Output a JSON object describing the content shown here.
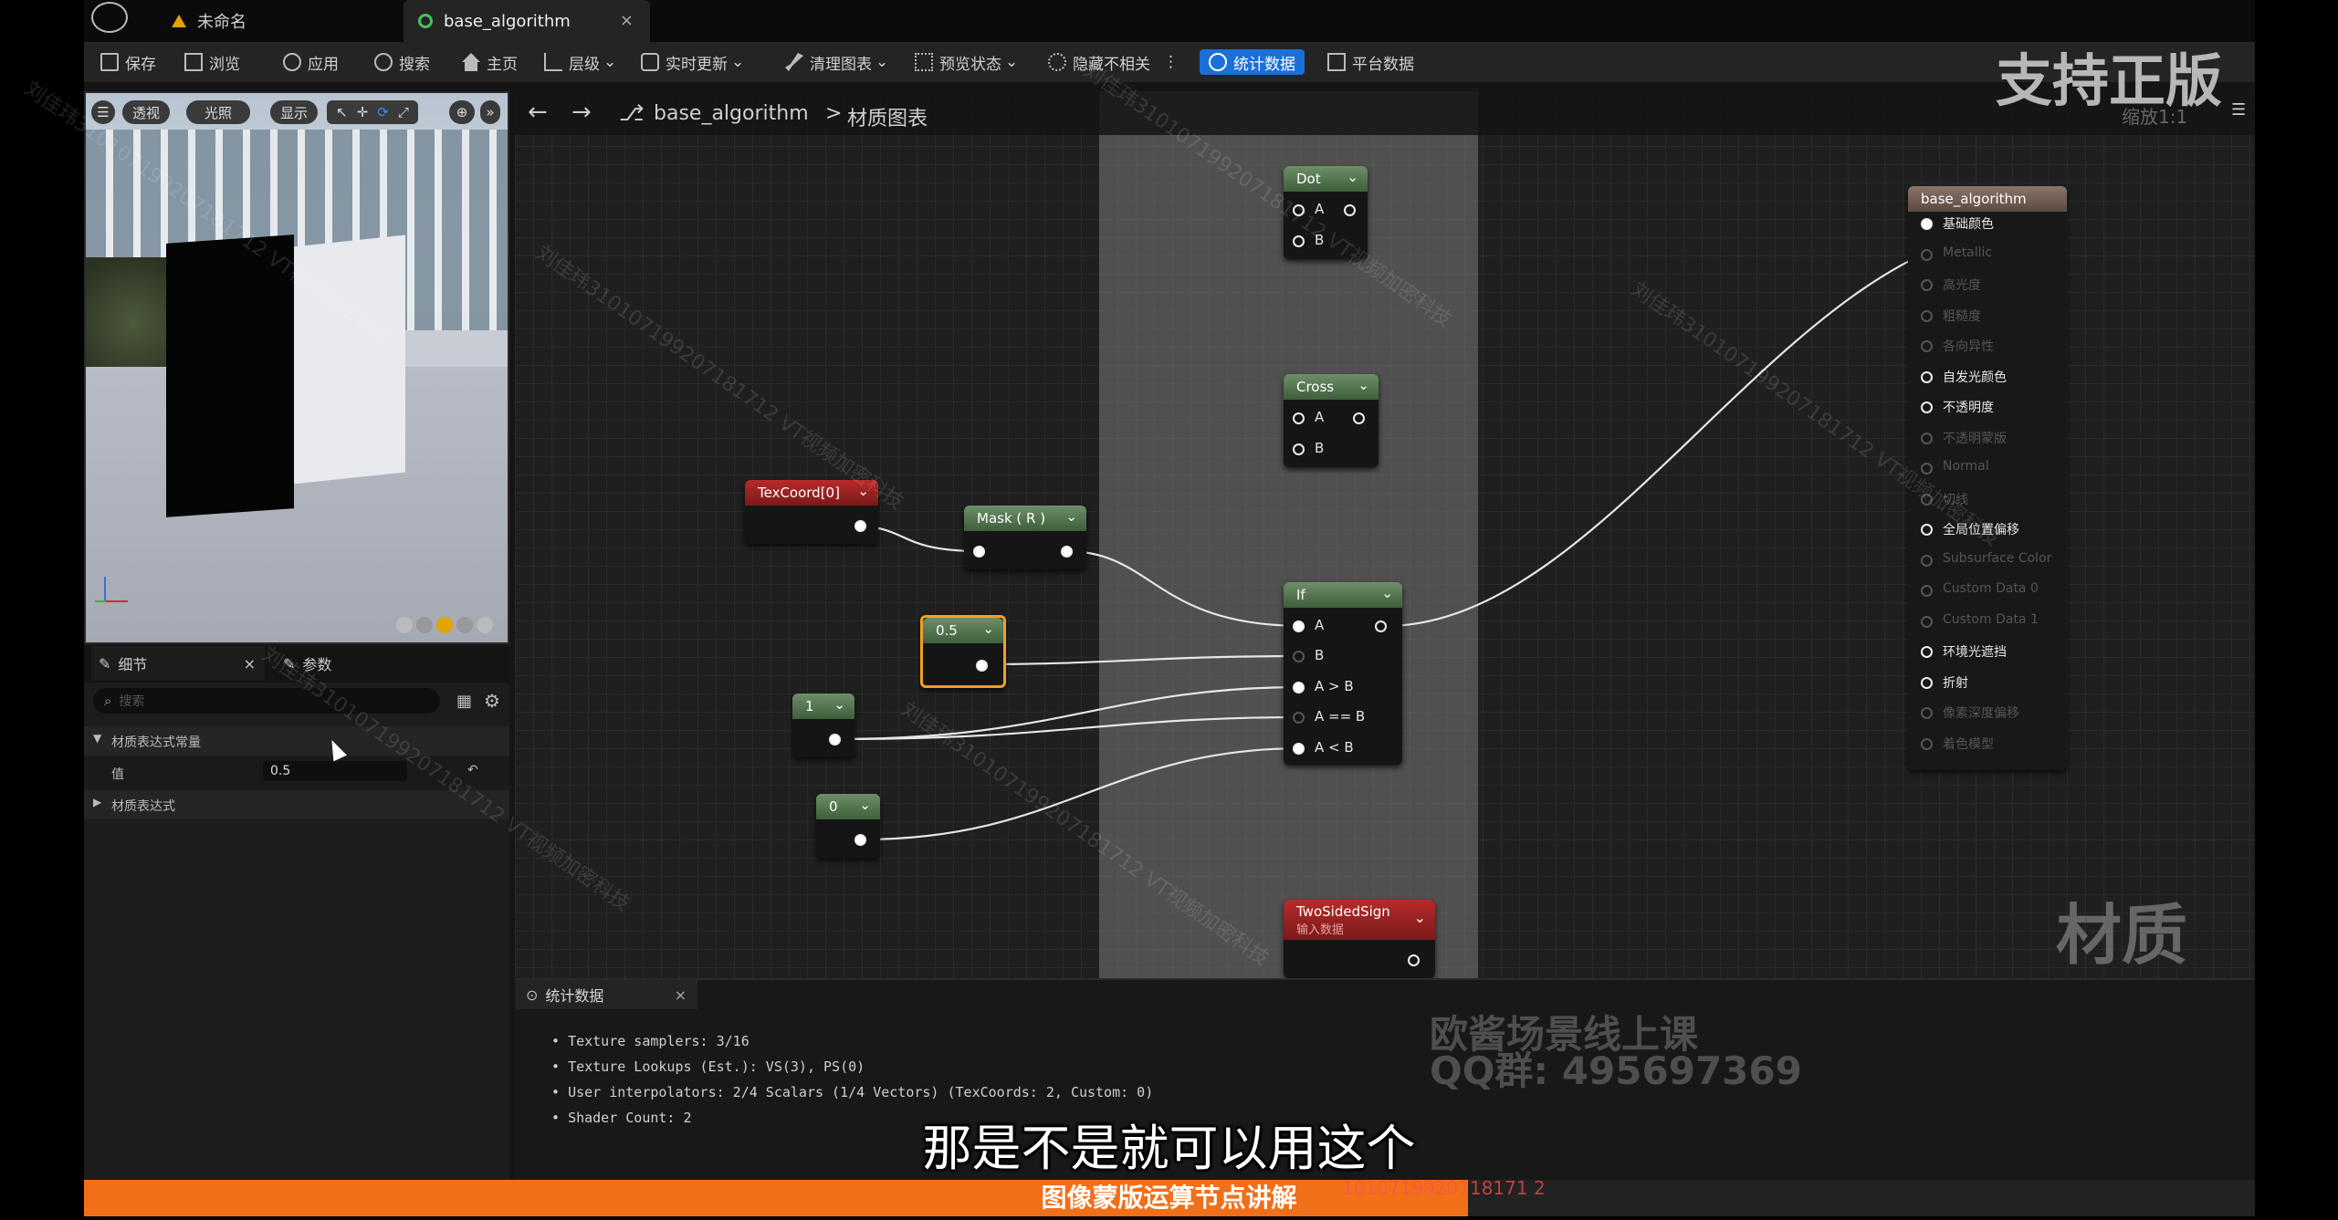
{
  "tabs": [
    {
      "label": "未命名",
      "active": false
    },
    {
      "label": "base_algorithm",
      "active": true
    }
  ],
  "toolbar": {
    "save": "保存",
    "browse": "浏览",
    "apply": "应用",
    "search": "搜索",
    "home": "主页",
    "hierarchy": "层级",
    "live_update": "实时更新",
    "clean_graph": "清理图表",
    "preview_state": "预览状态",
    "hide_unrelated": "隐藏不相关",
    "stats": "统计数据",
    "platform_stats": "平台数据"
  },
  "viewport": {
    "perspective": "透视",
    "lit": "光照",
    "show": "显示"
  },
  "details": {
    "tab_details": "细节",
    "tab_params": "参数",
    "search_placeholder": "搜索",
    "section_constant": "材质表达式常量",
    "value_label": "值",
    "value": "0.5",
    "section_expression": "材质表达式"
  },
  "graph": {
    "breadcrumb_root": "base_algorithm",
    "breadcrumb_sep": ">",
    "breadcrumb_leaf": "材质图表",
    "zoom": "缩放1:1"
  },
  "nodes": {
    "dot": {
      "title": "Dot",
      "pins": [
        "A",
        "B"
      ]
    },
    "cross": {
      "title": "Cross",
      "pins": [
        "A",
        "B"
      ]
    },
    "texcoord": {
      "title": "TexCoord[0]"
    },
    "mask": {
      "title": "Mask ( R )"
    },
    "half": {
      "title": "0.5"
    },
    "one": {
      "title": "1"
    },
    "zero": {
      "title": "0"
    },
    "if_node": {
      "title": "If",
      "pins": [
        "A",
        "B",
        "A > B",
        "A == B",
        "A < B"
      ]
    },
    "twosided": {
      "title": "TwoSidedSign",
      "subtitle": "输入数据"
    },
    "result": {
      "title": "base_algorithm",
      "pins": [
        {
          "label": "基础颜色",
          "active": true,
          "connected": true
        },
        {
          "label": "Metallic",
          "active": false
        },
        {
          "label": "高光度",
          "active": false
        },
        {
          "label": "粗糙度",
          "active": false
        },
        {
          "label": "各向异性",
          "active": false
        },
        {
          "label": "自发光颜色",
          "active": true
        },
        {
          "label": "不透明度",
          "active": true
        },
        {
          "label": "不透明蒙版",
          "active": false
        },
        {
          "label": "Normal",
          "active": false
        },
        {
          "label": "切线",
          "active": false
        },
        {
          "label": "全局位置偏移",
          "active": true
        },
        {
          "label": "Subsurface Color",
          "active": false
        },
        {
          "label": "Custom Data 0",
          "active": false
        },
        {
          "label": "Custom Data 1",
          "active": false
        },
        {
          "label": "环境光遮挡",
          "active": true
        },
        {
          "label": "折射",
          "active": true
        },
        {
          "label": "像素深度偏移",
          "active": false
        },
        {
          "label": "着色模型",
          "active": false
        }
      ]
    }
  },
  "stats_panel": {
    "title": "统计数据",
    "lines": [
      "Texture samplers: 3/16",
      "Texture Lookups (Est.): VS(3), PS(0)",
      "User interpolators: 2/4 Scalars (1/4 Vectors) (TexCoords: 2, Custom: 0)",
      "Shader Count: 2"
    ]
  },
  "overlay": {
    "brand": "支持正版",
    "material_label": "材质",
    "promo_line1": "欧酱场景线上课",
    "promo_line2": "QQ群: 495697369",
    "subtitle": "那是不是就可以用这个",
    "bottom_title": "图像蒙版运算节点讲解",
    "bottom_code": "1010719920718171 2",
    "watermark": "刘佳玮310107199207181712 VT视频加密科技"
  },
  "colors": {
    "accent": "#1b6fd8",
    "orange": "#f26f1a",
    "node_green": "#4f6e4b",
    "node_red": "#9a2222"
  }
}
